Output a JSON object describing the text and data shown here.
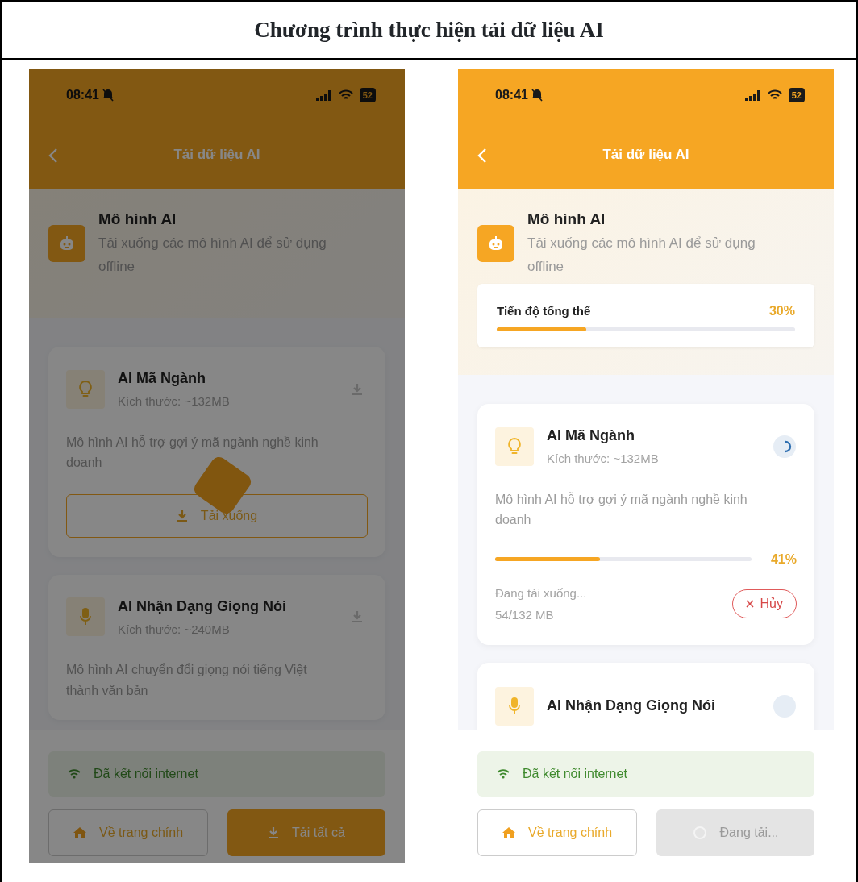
{
  "document_title": "Chương trình thực hiện tải dữ liệu AI",
  "phones": [
    {
      "dimmed": true,
      "tap_marker": true,
      "status_bar": {
        "time": "08:41",
        "battery": "52"
      },
      "header_title": "Tải dữ liệu AI",
      "intro": {
        "title": "Mô hình AI",
        "description": "Tải xuống các mô hình AI để sử dụng offline"
      },
      "models": [
        {
          "name": "AI Mã Ngành",
          "size": "Kích thước: ~132MB",
          "description": "Mô hình AI hỗ trợ gợi ý mã ngành nghề kinh doanh",
          "kind": "idle",
          "action_label": "Tải xuống"
        },
        {
          "name": "AI Nhận Dạng Giọng Nói",
          "size": "Kích thước: ~240MB",
          "description": "Mô hình AI chuyển đổi giọng nói tiếng Việt thành văn bản",
          "kind": "idle"
        }
      ],
      "connection": "Đã kết nối internet",
      "buttons": [
        {
          "label": "Về trang chính",
          "kind": "outline"
        },
        {
          "label": "Tải tất cả",
          "kind": "primary"
        }
      ]
    },
    {
      "dimmed": false,
      "tap_marker": false,
      "status_bar": {
        "time": "08:41",
        "battery": "52"
      },
      "header_title": "Tải dữ liệu AI",
      "intro": {
        "title": "Mô hình AI",
        "description": "Tải xuống các mô hình AI để sử dụng offline"
      },
      "overall_progress": {
        "label": "Tiến độ tổng thể",
        "value": "30%",
        "level": 0.3
      },
      "models": [
        {
          "name": "AI Mã Ngành",
          "size": "Kích thước: ~132MB",
          "description": "Mô hình AI hỗ trợ gợi ý mã ngành nghề kinh doanh",
          "kind": "downloading",
          "level": 0.41,
          "percent": "41%",
          "status": "Đang tải xuống...",
          "bytes": "54/132 MB",
          "cancel_label": "Hủy"
        },
        {
          "name": "AI Nhận Dạng Giọng Nói",
          "kind": "waiting"
        }
      ],
      "connection": "Đã kết nối internet",
      "buttons": [
        {
          "label": "Về trang chính",
          "kind": "outline"
        },
        {
          "label": "Đang tải...",
          "kind": "disabled"
        }
      ]
    }
  ]
}
